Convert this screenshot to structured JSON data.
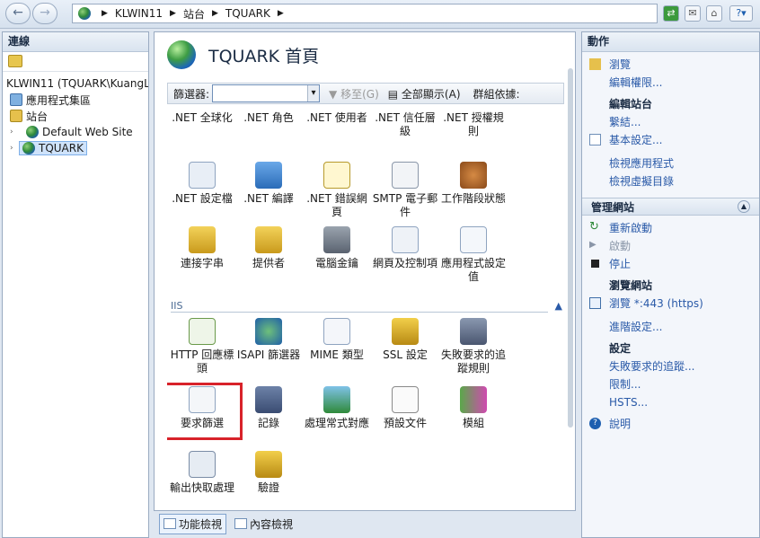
{
  "address_bar": {
    "segments": [
      "KLWIN11",
      "站台",
      "TQUARK"
    ]
  },
  "connections": {
    "title": "連線",
    "tree": [
      {
        "label": "KLWIN11 (TQUARK\\KuangL",
        "level": 0
      },
      {
        "label": "應用程式集區",
        "level": 1
      },
      {
        "label": "站台",
        "level": 1
      },
      {
        "label": "Default Web Site",
        "level": 2
      },
      {
        "label": "TQUARK",
        "level": 2,
        "selected": true
      }
    ]
  },
  "center": {
    "title": "TQUARK 首頁",
    "filter_label": "篩選器:",
    "go_label": "移至(G)",
    "show_all_label": "全部顯示(A)",
    "group_by_label": "群組依據:",
    "section_iis": "IIS",
    "row1": [
      ".NET 全球化",
      ".NET 角色",
      ".NET 使用者",
      ".NET 信任層級",
      ".NET 授權規則"
    ],
    "row2": [
      ".NET 設定檔",
      ".NET 編譯",
      ".NET 錯誤網頁",
      "SMTP 電子郵件",
      "工作階段狀態"
    ],
    "row3": [
      "連接字串",
      "提供者",
      "電腦金鑰",
      "網頁及控制項",
      "應用程式設定值"
    ],
    "row4": [
      "HTTP 回應標頭",
      "ISAPI 篩選器",
      "MIME 類型",
      "SSL 設定",
      "失敗要求的追蹤規則"
    ],
    "row5": [
      "要求篩選",
      "記錄",
      "處理常式對應",
      "預設文件",
      "模組"
    ],
    "row6": [
      "輸出快取處理",
      "驗證"
    ],
    "bottom_tabs": [
      "功能檢視",
      "內容檢視"
    ]
  },
  "actions": {
    "title": "動作",
    "links_top": [
      "瀏覽",
      "編輯權限..."
    ],
    "edit_site": "編輯站台",
    "edit_links": [
      "繫結...",
      "基本設定...",
      "檢視應用程式",
      "檢視虛擬目錄"
    ],
    "manage_site": "管理網站",
    "manage_links": [
      "重新啟動",
      "啟動",
      "停止"
    ],
    "browse_site": "瀏覽網站",
    "browse_link": "瀏覽 *:443 (https)",
    "advanced": "進階設定...",
    "settings": "設定",
    "settings_links": [
      "失敗要求的追蹤...",
      "限制...",
      "HSTS..."
    ],
    "help": "說明"
  },
  "colors": {
    "accent_link": "#2a5aa8",
    "highlight_box": "#d8222a"
  }
}
